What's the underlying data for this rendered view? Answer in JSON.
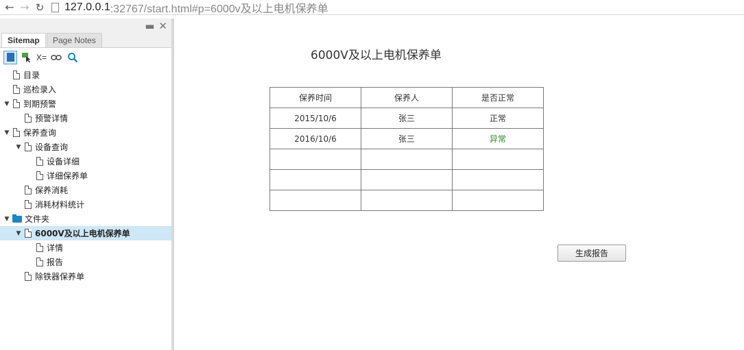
{
  "browser": {
    "back_icon": "←",
    "forward_icon": "→",
    "reload_icon": "↻",
    "url_host": "127.0.0.1",
    "url_rest": ":32767/start.html#p=6000v及以上电机保养单"
  },
  "sidebar": {
    "tabs": {
      "sitemap": "Sitemap",
      "notes": "Page Notes"
    },
    "controls": {
      "minimize": "▬",
      "close": "✕"
    },
    "toolbar": {
      "vars_label": "X=",
      "link_icon": "⚭",
      "search_icon": "🔍"
    },
    "tree": [
      {
        "label": "目录",
        "level": 0,
        "arrow": false,
        "type": "file"
      },
      {
        "label": "巡检录入",
        "level": 0,
        "arrow": false,
        "type": "file"
      },
      {
        "label": "到期预警",
        "level": 0,
        "arrow": true,
        "type": "file"
      },
      {
        "label": "预警详情",
        "level": 1,
        "arrow": false,
        "type": "file"
      },
      {
        "label": "保养查询",
        "level": 0,
        "arrow": true,
        "type": "file"
      },
      {
        "label": "设备查询",
        "level": 1,
        "arrow": true,
        "type": "file"
      },
      {
        "label": "设备详细",
        "level": 2,
        "arrow": false,
        "type": "file"
      },
      {
        "label": "详细保养单",
        "level": 2,
        "arrow": false,
        "type": "file"
      },
      {
        "label": "保养消耗",
        "level": 1,
        "arrow": false,
        "type": "file"
      },
      {
        "label": "消耗材料统计",
        "level": 1,
        "arrow": false,
        "type": "file"
      },
      {
        "label": "文件夹",
        "level": 0,
        "arrow": true,
        "type": "folder"
      },
      {
        "label": "6000V及以上电机保养单",
        "level": 1,
        "arrow": true,
        "type": "file",
        "selected": true
      },
      {
        "label": "详情",
        "level": 2,
        "arrow": false,
        "type": "file"
      },
      {
        "label": "报告",
        "level": 2,
        "arrow": false,
        "type": "file"
      },
      {
        "label": "除铁器保养单",
        "level": 1,
        "arrow": false,
        "type": "file"
      }
    ]
  },
  "main": {
    "title": "6000V及以上电机保养单",
    "table": {
      "headers": [
        "保养时间",
        "保养人",
        "是否正常"
      ],
      "rows": [
        [
          "2015/10/6",
          "张三",
          "正常"
        ],
        [
          "2016/10/6",
          "张三",
          "异常"
        ],
        [
          "",
          "",
          ""
        ],
        [
          "",
          "",
          ""
        ],
        [
          "",
          "",
          ""
        ]
      ]
    },
    "generate_button": "生成报告"
  },
  "colors": {
    "selected_row": "#cde8f6",
    "abnormal_text": "#2d8a2d",
    "folder": "#1b87c9"
  }
}
